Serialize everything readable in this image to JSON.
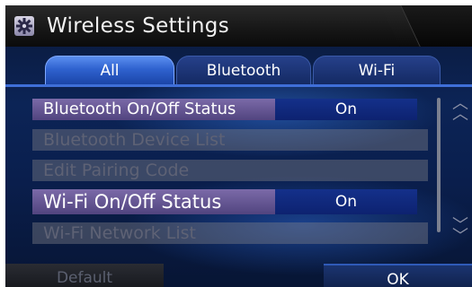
{
  "title": {
    "text": "Wireless Settings",
    "icon": "gear-icon"
  },
  "tabs": [
    {
      "label": "All",
      "selected": true
    },
    {
      "label": "Bluetooth",
      "selected": false
    },
    {
      "label": "Wi-Fi",
      "selected": false
    }
  ],
  "rows": [
    {
      "label": "Bluetooth On/Off Status",
      "value": "On",
      "enabled": true
    },
    {
      "label": "Bluetooth Device List",
      "enabled": false
    },
    {
      "label": "Edit Pairing Code",
      "enabled": false
    },
    {
      "label": "Wi-Fi On/Off Status",
      "value": "On",
      "enabled": true
    },
    {
      "label": "Wi-Fi Network List",
      "enabled": false
    }
  ],
  "buttons": {
    "default_label": "Default",
    "ok_label": "OK"
  },
  "colors": {
    "accent": "#3f6fd8",
    "active_row": "#6a5a98",
    "value_bg": "#14308a"
  }
}
